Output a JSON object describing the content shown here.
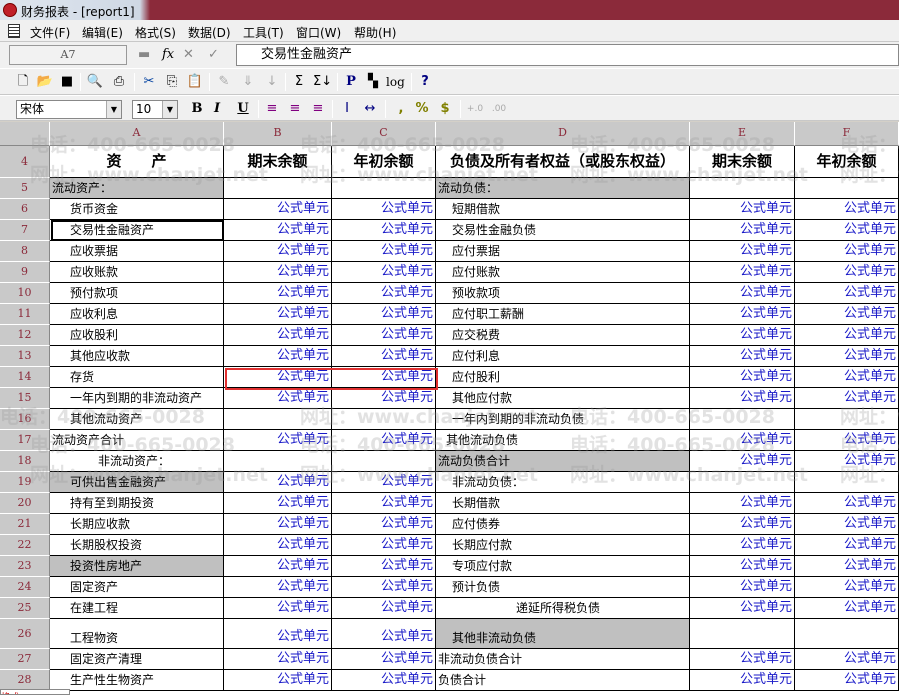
{
  "window": {
    "title": "财务报表 - [report1]"
  },
  "menu": [
    "文件(F)",
    "编辑(E)",
    "格式(S)",
    "数据(D)",
    "工具(T)",
    "窗口(W)",
    "帮助(H)"
  ],
  "formula_bar": {
    "cell_ref": "A7",
    "fx": "fx",
    "cancel": "✕",
    "confirm": "✓",
    "value": "交易性金融资产"
  },
  "toolbar2": {
    "font": "宋体",
    "size": "10",
    "bold": "B",
    "italic": "I",
    "underline": "U",
    "comma": ",",
    "percent": "%",
    "currency": "$",
    "inc_decimal": "+.0",
    "dec_decimal": ".00"
  },
  "toolbar1": {
    "p": "P",
    "log": "log",
    "help": "?"
  },
  "columns": [
    "A",
    "B",
    "C",
    "D",
    "E",
    "F"
  ],
  "header": {
    "num": "4",
    "a": "资　　产",
    "b": "期末余额",
    "c": "年初余额",
    "d": "负债及所有者权益（或股东权益）",
    "e": "期末余额",
    "f": "年初余额"
  },
  "rows": [
    {
      "num": "5",
      "a": "流动资产：",
      "b": "",
      "c": "",
      "d": "流动负债：",
      "e": "",
      "f": ""
    },
    {
      "num": "6",
      "a": "货币资金",
      "b": "公式单元",
      "c": "公式单元",
      "d": "短期借款",
      "e": "公式单元",
      "f": "公式单元"
    },
    {
      "num": "7",
      "a": "交易性金融资产",
      "b": "公式单元",
      "c": "公式单元",
      "d": "交易性金融负债",
      "e": "公式单元",
      "f": "公式单元"
    },
    {
      "num": "8",
      "a": "应收票据",
      "b": "公式单元",
      "c": "公式单元",
      "d": "应付票据",
      "e": "公式单元",
      "f": "公式单元"
    },
    {
      "num": "9",
      "a": "应收账款",
      "b": "公式单元",
      "c": "公式单元",
      "d": "应付账款",
      "e": "公式单元",
      "f": "公式单元"
    },
    {
      "num": "10",
      "a": "预付款项",
      "b": "公式单元",
      "c": "公式单元",
      "d": "预收款项",
      "e": "公式单元",
      "f": "公式单元"
    },
    {
      "num": "11",
      "a": "应收利息",
      "b": "公式单元",
      "c": "公式单元",
      "d": "应付职工薪酬",
      "e": "公式单元",
      "f": "公式单元"
    },
    {
      "num": "12",
      "a": "应收股利",
      "b": "公式单元",
      "c": "公式单元",
      "d": "应交税费",
      "e": "公式单元",
      "f": "公式单元"
    },
    {
      "num": "13",
      "a": "其他应收款",
      "b": "公式单元",
      "c": "公式单元",
      "d": "应付利息",
      "e": "公式单元",
      "f": "公式单元"
    },
    {
      "num": "14",
      "a": "存货",
      "b": "公式单元",
      "c": "公式单元",
      "d": "应付股利",
      "e": "公式单元",
      "f": "公式单元"
    },
    {
      "num": "15",
      "a": "一年内到期的非流动资产",
      "b": "公式单元",
      "c": "公式单元",
      "d": "其他应付款",
      "e": "公式单元",
      "f": "公式单元"
    },
    {
      "num": "16",
      "a": "其他流动资产",
      "b": "",
      "c": "",
      "d": "一年内到期的非流动负债",
      "e": "",
      "f": ""
    },
    {
      "num": "17",
      "a": "流动资产合计",
      "b": "公式单元",
      "c": "公式单元",
      "d": "其他流动负债",
      "e": "公式单元",
      "f": "公式单元"
    },
    {
      "num": "18",
      "a": "非流动资产：",
      "b": "",
      "c": "",
      "d": "流动负债合计",
      "e": "公式单元",
      "f": "公式单元"
    },
    {
      "num": "19",
      "a": "可供出售金融资产",
      "b": "公式单元",
      "c": "公式单元",
      "d": "非流动负债：",
      "e": "",
      "f": ""
    },
    {
      "num": "20",
      "a": "持有至到期投资",
      "b": "公式单元",
      "c": "公式单元",
      "d": "长期借款",
      "e": "公式单元",
      "f": "公式单元"
    },
    {
      "num": "21",
      "a": "长期应收款",
      "b": "公式单元",
      "c": "公式单元",
      "d": "应付债券",
      "e": "公式单元",
      "f": "公式单元"
    },
    {
      "num": "22",
      "a": "长期股权投资",
      "b": "公式单元",
      "c": "公式单元",
      "d": "长期应付款",
      "e": "公式单元",
      "f": "公式单元"
    },
    {
      "num": "23",
      "a": "投资性房地产",
      "b": "公式单元",
      "c": "公式单元",
      "d": "专项应付款",
      "e": "公式单元",
      "f": "公式单元"
    },
    {
      "num": "24",
      "a": "固定资产",
      "b": "公式单元",
      "c": "公式单元",
      "d": "预计负债",
      "e": "公式单元",
      "f": "公式单元"
    },
    {
      "num": "25",
      "a": "在建工程",
      "b": "公式单元",
      "c": "公式单元",
      "d": "递延所得税负债",
      "e": "公式单元",
      "f": "公式单元"
    },
    {
      "num": "26",
      "a": "工程物资",
      "b": "公式单元",
      "c": "公式单元",
      "d": "其他非流动负债",
      "e": "",
      "f": ""
    },
    {
      "num": "27",
      "a": "固定资产清理",
      "b": "公式单元",
      "c": "公式单元",
      "d": "非流动负债合计",
      "e": "公式单元",
      "f": "公式单元"
    },
    {
      "num": "28",
      "a": "生产性生物资产",
      "b": "公式单元",
      "c": "公式单元",
      "d": "负债合计",
      "e": "公式单元",
      "f": "公式单元"
    }
  ],
  "watermark": {
    "phone": "电话：400-665-0028",
    "site": "网址：www.chanjet.net"
  },
  "sheet_tab": "格式",
  "colors": {
    "formula_text": "#1a1ac8",
    "selection_red": "#e03030",
    "gray_cell": "#c0c0c0",
    "titlebar": "#8b2a3a"
  }
}
